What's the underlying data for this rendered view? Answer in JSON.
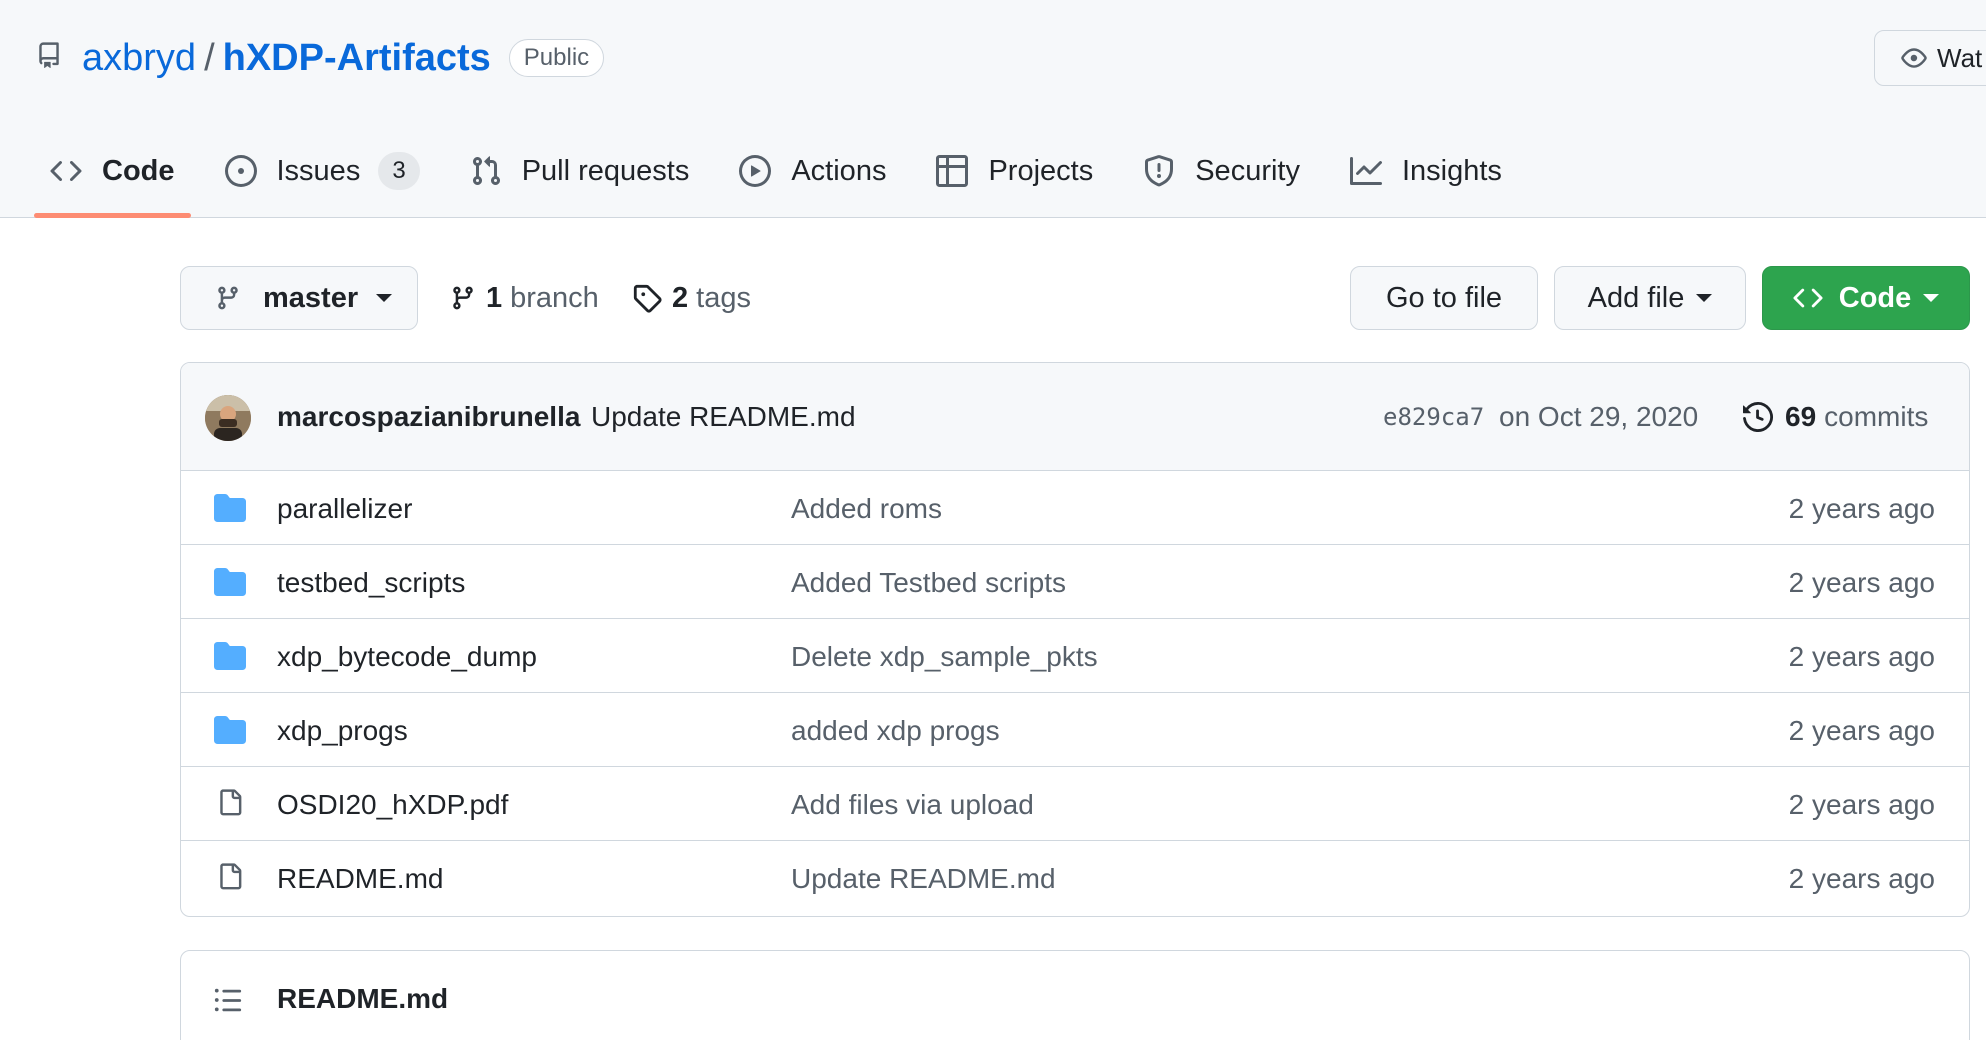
{
  "repo": {
    "owner": "axbryd",
    "separator": "/",
    "name": "hXDP-Artifacts",
    "visibility": "Public"
  },
  "watch_button": {
    "label": "Wat",
    "icon": "eye-icon"
  },
  "tabs": [
    {
      "label": "Code",
      "icon": "code-icon",
      "active": true
    },
    {
      "label": "Issues",
      "icon": "issue-opened-icon",
      "count": "3"
    },
    {
      "label": "Pull requests",
      "icon": "git-pull-request-icon"
    },
    {
      "label": "Actions",
      "icon": "play-icon"
    },
    {
      "label": "Projects",
      "icon": "table-icon"
    },
    {
      "label": "Security",
      "icon": "shield-icon"
    },
    {
      "label": "Insights",
      "icon": "graph-icon"
    }
  ],
  "toolbar": {
    "branch_name": "master",
    "branches_count": "1",
    "branches_label": "branch",
    "tags_count": "2",
    "tags_label": "tags",
    "go_to_file": "Go to file",
    "add_file": "Add file",
    "code_button": "Code"
  },
  "latest_commit": {
    "author": "marcospazianibrunella",
    "message": "Update README.md",
    "sha": "e829ca7",
    "date": "on Oct 29, 2020",
    "commits_count": "69",
    "commits_label": "commits"
  },
  "files": [
    {
      "type": "folder",
      "name": "parallelizer",
      "message": "Added roms",
      "age": "2 years ago"
    },
    {
      "type": "folder",
      "name": "testbed_scripts",
      "message": "Added Testbed scripts",
      "age": "2 years ago"
    },
    {
      "type": "folder",
      "name": "xdp_bytecode_dump",
      "message": "Delete xdp_sample_pkts",
      "age": "2 years ago"
    },
    {
      "type": "folder",
      "name": "xdp_progs",
      "message": "added xdp progs",
      "age": "2 years ago"
    },
    {
      "type": "file",
      "name": "OSDI20_hXDP.pdf",
      "message": "Add files via upload",
      "age": "2 years ago"
    },
    {
      "type": "file",
      "name": "README.md",
      "message": "Update README.md",
      "age": "2 years ago"
    }
  ],
  "readme": {
    "title": "README.md",
    "icon": "list-unordered-icon"
  },
  "colors": {
    "link": "#0969da",
    "primary_button": "#2da44e",
    "folder_icon": "#54aeff",
    "active_tab_underline": "#fd8c73"
  }
}
